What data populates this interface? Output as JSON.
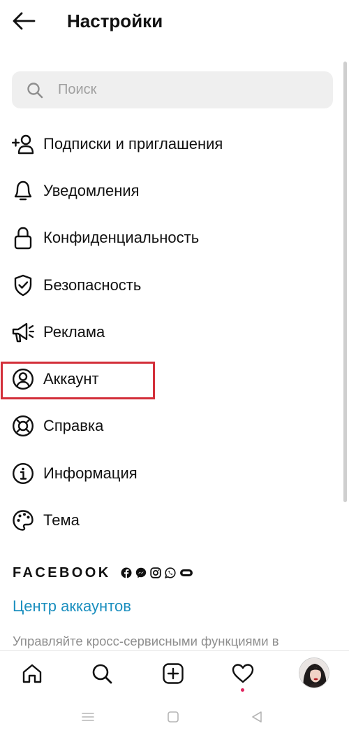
{
  "header": {
    "title": "Настройки"
  },
  "search": {
    "placeholder": "Поиск"
  },
  "menu": {
    "items": [
      {
        "label": "Подписки и приглашения",
        "icon": "add-person-icon"
      },
      {
        "label": "Уведомления",
        "icon": "bell-icon"
      },
      {
        "label": "Конфиденциальность",
        "icon": "lock-icon"
      },
      {
        "label": "Безопасность",
        "icon": "shield-check-icon"
      },
      {
        "label": "Реклама",
        "icon": "megaphone-icon"
      },
      {
        "label": "Аккаунт",
        "icon": "user-circle-icon",
        "highlighted": true
      },
      {
        "label": "Справка",
        "icon": "lifebuoy-icon"
      },
      {
        "label": "Информация",
        "icon": "info-icon"
      },
      {
        "label": "Тема",
        "icon": "palette-icon"
      }
    ]
  },
  "facebook": {
    "title": "FACEBOOK",
    "icons": [
      "facebook-icon",
      "messenger-icon",
      "instagram-icon",
      "whatsapp-icon",
      "portal-icon"
    ],
    "accounts_center": "Центр аккаунтов",
    "accounts_description": "Управляйте кросс-сервисными функциями в"
  },
  "bottom_nav": {
    "items": [
      "home-icon",
      "search-icon",
      "new-post-icon",
      "activity-heart-icon",
      "profile-avatar"
    ]
  },
  "colors": {
    "link": "#1b8fbf",
    "highlight_border": "#d32f3a",
    "search_bg": "#efefef",
    "notification_dot": "#e0245e"
  }
}
